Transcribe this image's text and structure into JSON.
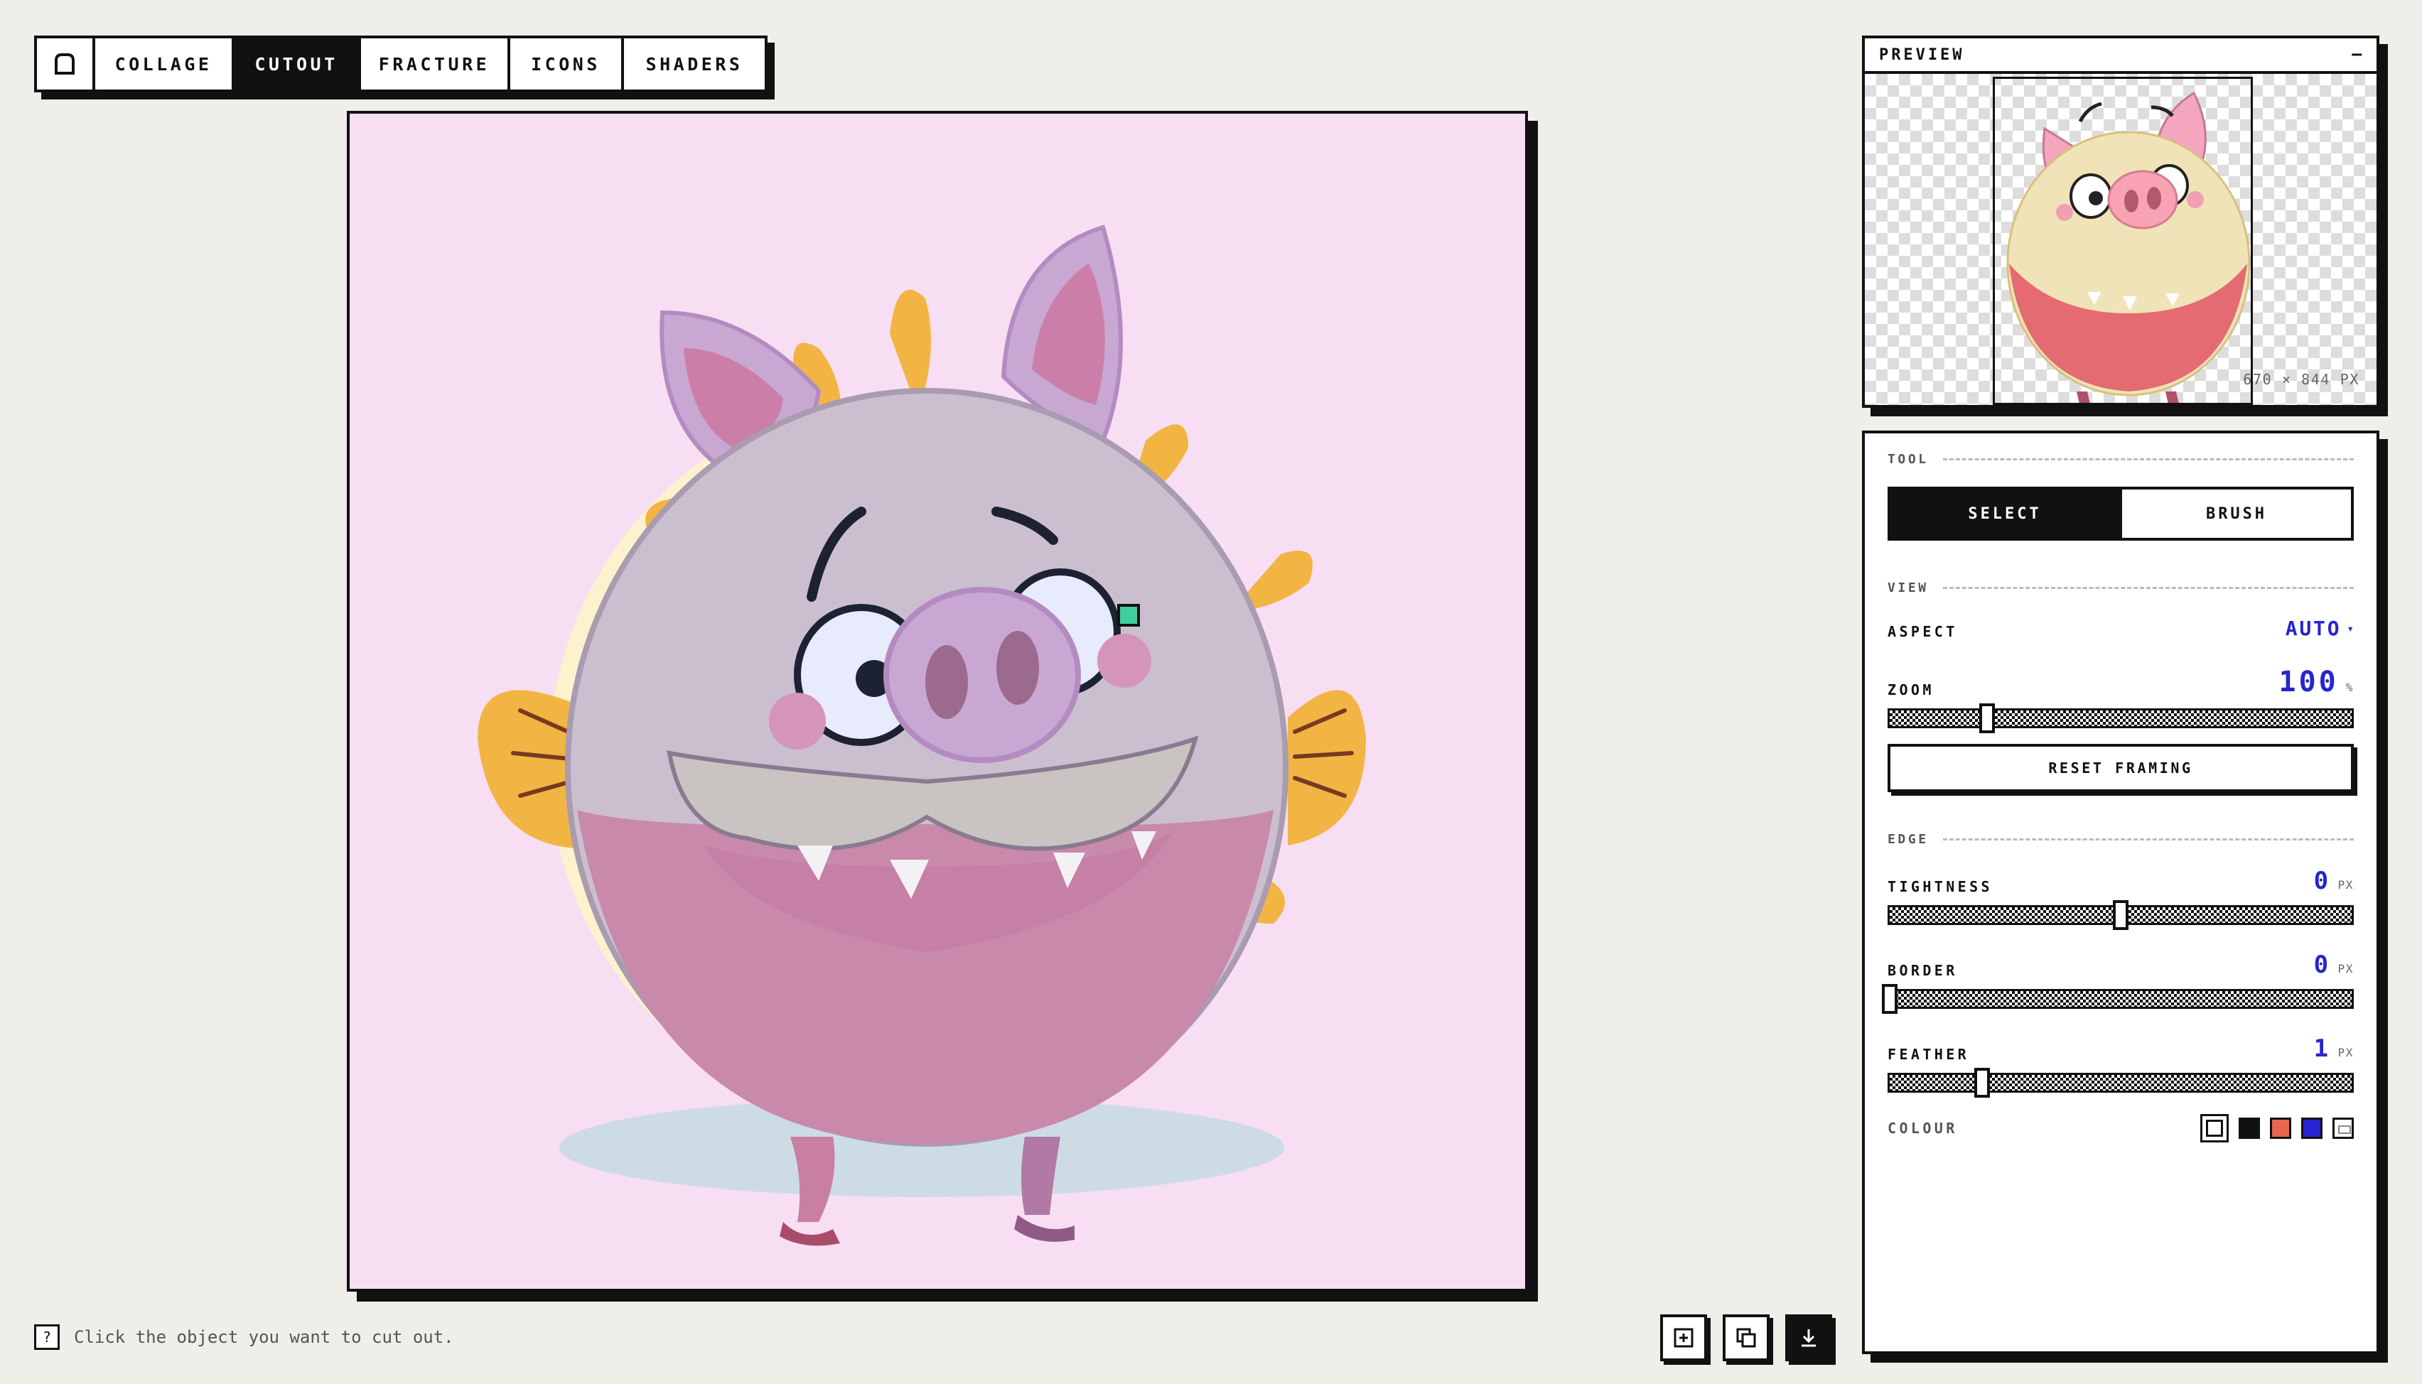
{
  "tabs": {
    "home_icon": "home-icon",
    "items": [
      {
        "label": "COLLAGE",
        "active": false
      },
      {
        "label": "CUTOUT",
        "active": true
      },
      {
        "label": "FRACTURE",
        "active": false
      },
      {
        "label": "ICONS",
        "active": false
      },
      {
        "label": "SHADERS",
        "active": false
      }
    ]
  },
  "hint": {
    "icon": "?",
    "text": "Click the object you want to cut out."
  },
  "preview": {
    "title": "PREVIEW",
    "collapse": "−",
    "dims": "670 × 844 PX"
  },
  "controls": {
    "tool_section": "TOOL",
    "tool_select": "SELECT",
    "tool_brush": "BRUSH",
    "view_section": "VIEW",
    "aspect_label": "ASPECT",
    "aspect_value": "AUTO",
    "zoom_label": "ZOOM",
    "zoom_value": "100",
    "zoom_unit": "%",
    "zoom_fraction": 0.21,
    "reset_label": "RESET FRAMING",
    "edge_section": "EDGE",
    "tightness_label": "TIGHTNESS",
    "tightness_value": "0",
    "tightness_unit": "PX",
    "tightness_fraction": 0.5,
    "border_label": "BORDER",
    "border_value": "0",
    "border_unit": "PX",
    "border_fraction": 0.0,
    "feather_label": "FEATHER",
    "feather_value": "1",
    "feather_unit": "PX",
    "feather_fraction": 0.2,
    "colour_label": "COLOUR",
    "colours": [
      "#ffffff",
      "#111111",
      "#e8664f",
      "#2525d0"
    ]
  },
  "colors": {
    "background": "#efeee9",
    "canvas_bg": "#f8def3",
    "accent_blue": "#2525d0"
  }
}
